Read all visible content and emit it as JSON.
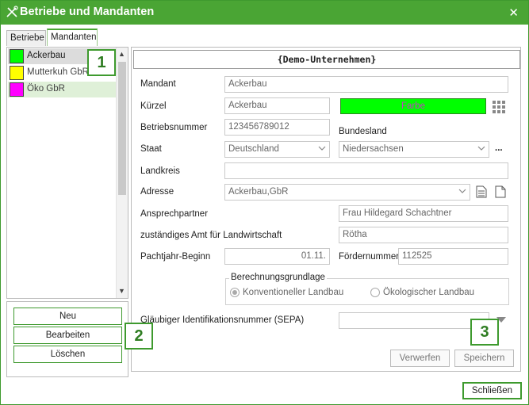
{
  "window": {
    "title": "Betriebe und Mandanten",
    "close_glyph": "✕"
  },
  "tabs": [
    {
      "label": "Betriebe"
    },
    {
      "label": "Mandanten"
    }
  ],
  "list": {
    "items": [
      {
        "label": "Ackerbau",
        "color": "#00ff00"
      },
      {
        "label": "Mutterkuh GbR",
        "color": "#ffff00"
      },
      {
        "label": "Öko GbR",
        "color": "#ff00ff"
      }
    ],
    "scroll_up": "▲",
    "scroll_down": "▼"
  },
  "list_buttons": {
    "new": "Neu",
    "edit": "Bearbeiten",
    "delete": "Löschen"
  },
  "callouts": [
    "1",
    "2",
    "3"
  ],
  "form": {
    "heading": "{Demo-Unternehmen}",
    "mandant": {
      "label": "Mandant",
      "value": "Ackerbau"
    },
    "kuerzel": {
      "label": "Kürzel",
      "value": "Ackerbau"
    },
    "farbe": {
      "label": "Farbe",
      "color": "#00ff00"
    },
    "betriebsnummer": {
      "label": "Betriebsnummer",
      "value": "123456789012"
    },
    "bundesland": {
      "label": "Bundesland",
      "value": "Niedersachsen"
    },
    "staat": {
      "label": "Staat",
      "value": "Deutschland"
    },
    "more_glyph": "...",
    "landkreis": {
      "label": "Landkreis",
      "value": ""
    },
    "adresse": {
      "label": "Adresse",
      "value": "Ackerbau,GbR"
    },
    "ansprechpartner": {
      "label": "Ansprechpartner",
      "value": "Frau Hildegard Schachtner"
    },
    "amt": {
      "label": "zuständiges Amt für Landwirtschaft",
      "value": "Rötha"
    },
    "pachtjahr": {
      "label": "Pachtjahr-Beginn",
      "value": "01.11."
    },
    "foerdernummer": {
      "label": "Fördernummer",
      "value": "112525"
    },
    "berechnungsgrundlage": {
      "label": "Berechnungsgrundlage",
      "options": [
        {
          "label": "Konventioneller Landbau",
          "checked": true
        },
        {
          "label": "Ökologischer Landbau",
          "checked": false
        }
      ]
    },
    "sepa": {
      "label": "Gläubiger Identifikationsnummer (SEPA)",
      "value": ""
    }
  },
  "action_buttons": {
    "discard": "Verwerfen",
    "save": "Speichern",
    "close": "Schließen"
  }
}
